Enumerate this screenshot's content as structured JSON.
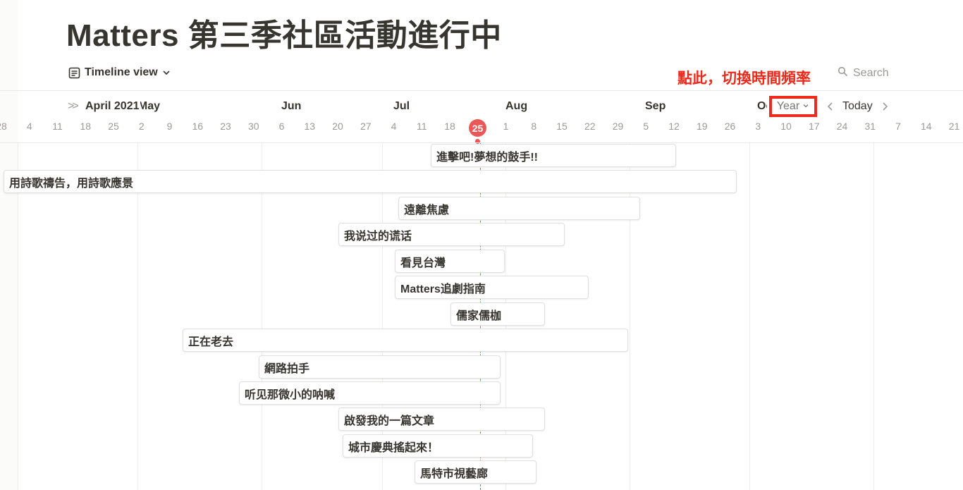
{
  "page": {
    "title": "Matters 第三季社區活動進行中"
  },
  "toolbar": {
    "view_label": "Timeline view",
    "annotation": "點此，切換時間頻率",
    "search_placeholder": "Search"
  },
  "timeline": {
    "month_labels": [
      "April 2021",
      "May",
      "Jun",
      "Jul",
      "Aug",
      "Sep",
      "Oct"
    ],
    "day_labels": [
      "28",
      "4",
      "11",
      "18",
      "25",
      "2",
      "9",
      "16",
      "23",
      "30",
      "6",
      "13",
      "20",
      "27",
      "4",
      "11",
      "18",
      "25",
      "1",
      "8",
      "15",
      "22",
      "29",
      "5",
      "12",
      "19",
      "26",
      "3",
      "10",
      "17",
      "24",
      "31",
      "7",
      "14",
      "21"
    ],
    "today_label": "25",
    "scale_label": "Year",
    "today_button": "Today"
  },
  "items": [
    {
      "title": "進擊吧!夢想的鼓手!!"
    },
    {
      "title": "用詩歌禱告，用詩歌應景"
    },
    {
      "title": "遠離焦慮"
    },
    {
      "title": "我说过的谎话"
    },
    {
      "title": "看見台灣"
    },
    {
      "title": "Matters追劇指南"
    },
    {
      "title": "儒家儒枷"
    },
    {
      "title": "正在老去"
    },
    {
      "title": "網路拍手"
    },
    {
      "title": "听见那微小的呐喊"
    },
    {
      "title": "啟發我的一篇文章"
    },
    {
      "title": "城市慶典搖起來！"
    },
    {
      "title": "馬特市視藝廊"
    }
  ],
  "colors": {
    "accent_red": "#eb5757",
    "annotation_red": "#eb2a1c",
    "text": "#37352f",
    "muted": "#9b9a97"
  },
  "icons": [
    "document-list-icon",
    "chevron-down-icon",
    "search-icon",
    "double-chevron-left-icon",
    "chevron-left-icon",
    "chevron-right-icon"
  ]
}
